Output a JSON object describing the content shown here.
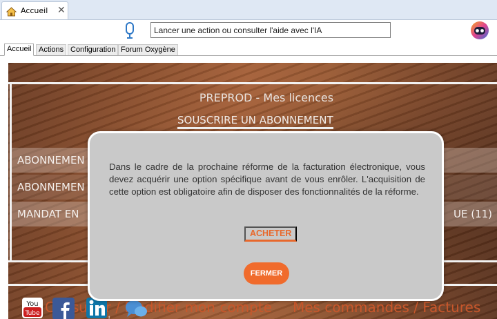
{
  "window": {
    "tab_title": "Accueil"
  },
  "toolbar": {
    "ia_placeholder": "Lancer une action ou consulter l'aide avec l'IA"
  },
  "nav": {
    "tabs": [
      {
        "label": "Accueil",
        "active": true
      },
      {
        "label": "Actions"
      },
      {
        "label": "Configuration"
      },
      {
        "label": "Forum Oxygène"
      }
    ]
  },
  "licences": {
    "title": "PREPROD - Mes licences",
    "subscribe": "SOUSCRIRE UN ABONNEMENT",
    "row1": "ABONNEMEN",
    "row2": "ABONNEMEN",
    "row3_left": "MANDAT EN",
    "row3_right": "UE (11)"
  },
  "footer": {
    "account_link": "Consulter / Modifier mon compte",
    "orders_link": "Mes commandes / Factures"
  },
  "modal": {
    "message": "Dans le cadre de la prochaine réforme de la facturation électronique, vous devez acquérir une option spécifique avant de vous enrôler. L'acquisition de cette option est obligatoire afin de disposer des fonctionnalités de la réforme.",
    "buy_label": "ACHETER",
    "close_label": "FERMER"
  },
  "colors": {
    "accent": "#f06b2c",
    "modal_bg": "#c9c9c9",
    "brand_orange": "#c9572b"
  },
  "icons": [
    "home-icon",
    "close-icon",
    "microphone-icon",
    "ai-robot-icon",
    "youtube-icon",
    "facebook-icon",
    "linkedin-icon",
    "chat-icon"
  ]
}
